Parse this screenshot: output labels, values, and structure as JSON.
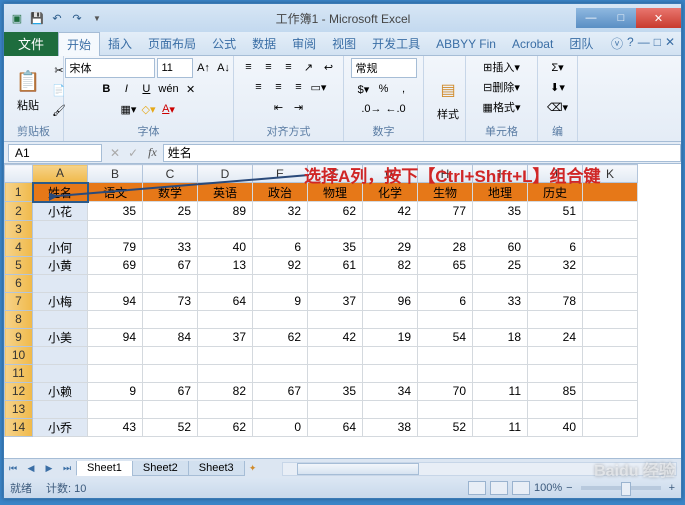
{
  "titlebar": {
    "title": "工作簿1 - Microsoft Excel"
  },
  "win": {
    "min": "—",
    "max": "□",
    "close": "✕"
  },
  "tabs": {
    "file": "文件",
    "items": [
      "开始",
      "插入",
      "页面布局",
      "公式",
      "数据",
      "审阅",
      "视图",
      "开发工具",
      "ABBYY Fin",
      "Acrobat",
      "团队"
    ],
    "help": "?"
  },
  "ribbon": {
    "clipboard": {
      "paste": "粘贴",
      "label": "剪贴板"
    },
    "font": {
      "name": "宋体",
      "size": "11",
      "label": "字体"
    },
    "align": {
      "label": "对齐方式"
    },
    "number": {
      "format": "常规",
      "label": "数字"
    },
    "styles": {
      "btn": "样式",
      "label": ""
    },
    "cells": {
      "insert": "插入",
      "delete": "删除",
      "format": "格式",
      "label": "单元格"
    },
    "editing": {
      "label": "编"
    }
  },
  "namebox": "A1",
  "formula": "姓名",
  "annotation": "选择A列，按下【Ctrl+Shift+L】组合键",
  "columns": [
    "A",
    "B",
    "C",
    "D",
    "E",
    "F",
    "G",
    "H",
    "I",
    "J",
    "K"
  ],
  "headers": [
    "姓名",
    "语文",
    "数学",
    "英语",
    "政治",
    "物理",
    "化学",
    "生物",
    "地理",
    "历史"
  ],
  "rows": [
    {
      "n": "1"
    },
    {
      "n": "2",
      "name": "小花",
      "v": [
        "35",
        "25",
        "89",
        "32",
        "62",
        "42",
        "77",
        "35",
        "51"
      ]
    },
    {
      "n": "3"
    },
    {
      "n": "4",
      "name": "小何",
      "v": [
        "79",
        "33",
        "40",
        "6",
        "35",
        "29",
        "28",
        "60",
        "6"
      ]
    },
    {
      "n": "5",
      "name": "小黄",
      "v": [
        "69",
        "67",
        "13",
        "92",
        "61",
        "82",
        "65",
        "25",
        "32"
      ]
    },
    {
      "n": "6"
    },
    {
      "n": "7",
      "name": "小梅",
      "v": [
        "94",
        "73",
        "64",
        "9",
        "37",
        "96",
        "6",
        "33",
        "78"
      ]
    },
    {
      "n": "8"
    },
    {
      "n": "9",
      "name": "小美",
      "v": [
        "94",
        "84",
        "37",
        "62",
        "42",
        "19",
        "54",
        "18",
        "24"
      ]
    },
    {
      "n": "10"
    },
    {
      "n": "11"
    },
    {
      "n": "12",
      "name": "小赖",
      "v": [
        "9",
        "67",
        "82",
        "67",
        "35",
        "34",
        "70",
        "11",
        "85"
      ]
    },
    {
      "n": "13"
    },
    {
      "n": "14",
      "name": "小乔",
      "v": [
        "43",
        "52",
        "62",
        "0",
        "64",
        "38",
        "52",
        "11",
        "40"
      ]
    }
  ],
  "sheets": [
    "Sheet1",
    "Sheet2",
    "Sheet3"
  ],
  "status": {
    "ready": "就绪",
    "count_label": "计数:",
    "count": "10",
    "zoom": "100%"
  },
  "watermark": "Baidu 经验"
}
